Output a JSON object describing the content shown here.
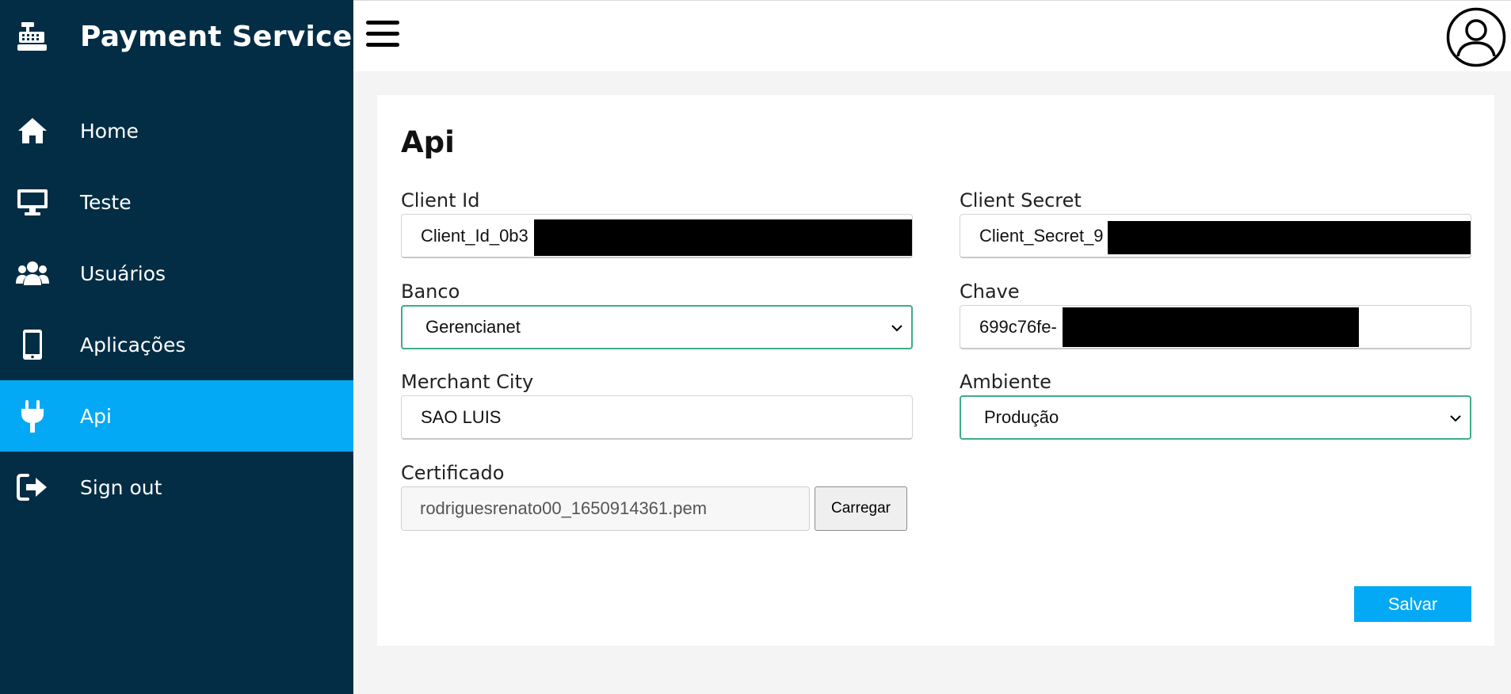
{
  "app": {
    "title": "Payment Service",
    "brand_icon": "cash-register-icon"
  },
  "colors": {
    "sidebar_bg": "#022d45",
    "active_item": "#03a9f4",
    "save_button": "#03a9f4",
    "focus_border": "#3cae84"
  },
  "sidebar": {
    "items": [
      {
        "label": "Home",
        "icon": "home-icon"
      },
      {
        "label": "Teste",
        "icon": "desktop-icon"
      },
      {
        "label": "Usuários",
        "icon": "users-icon"
      },
      {
        "label": "Aplicações",
        "icon": "mobile-icon"
      },
      {
        "label": "Api",
        "icon": "plug-icon",
        "active": true
      },
      {
        "label": "Sign out",
        "icon": "sign-out-icon"
      }
    ]
  },
  "topbar": {
    "menu_icon": "hamburger-icon",
    "user_icon": "user-circle-icon"
  },
  "page": {
    "title": "Api"
  },
  "form": {
    "client_id": {
      "label": "Client Id",
      "value": "Client_Id_0b3"
    },
    "client_secret": {
      "label": "Client Secret",
      "value": "Client_Secret_9"
    },
    "banco": {
      "label": "Banco",
      "selected": "Gerencianet"
    },
    "chave": {
      "label": "Chave",
      "value": "699c76fe-"
    },
    "merchant_city": {
      "label": "Merchant City",
      "value": "SAO LUIS"
    },
    "ambiente": {
      "label": "Ambiente",
      "selected": "Produção"
    },
    "certificado": {
      "label": "Certificado",
      "value": "rodriguesrenato00_1650914361.pem",
      "button": "Carregar"
    },
    "save_label": "Salvar"
  }
}
